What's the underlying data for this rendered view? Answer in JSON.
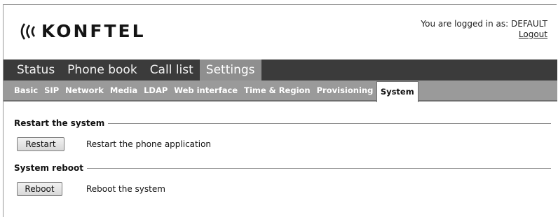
{
  "header": {
    "logo_text": "KONFTEL",
    "logged_in_text": "You are logged in as: DEFAULT",
    "logout_label": "Logout"
  },
  "main_nav": {
    "items": [
      {
        "label": "Status"
      },
      {
        "label": "Phone book"
      },
      {
        "label": "Call list"
      },
      {
        "label": "Settings"
      }
    ],
    "active": "Settings"
  },
  "sub_nav": {
    "items": [
      {
        "label": "Basic"
      },
      {
        "label": "SIP"
      },
      {
        "label": "Network"
      },
      {
        "label": "Media"
      },
      {
        "label": "LDAP"
      },
      {
        "label": "Web interface"
      },
      {
        "label": "Time & Region"
      },
      {
        "label": "Provisioning"
      },
      {
        "label": "System"
      }
    ],
    "active": "System"
  },
  "sections": {
    "restart": {
      "title": "Restart the system",
      "button_label": "Restart",
      "description": "Restart the phone application"
    },
    "reboot": {
      "title": "System reboot",
      "button_label": "Reboot",
      "description": "Reboot the system"
    }
  },
  "colors": {
    "main_nav_bg": "#3b3b3b",
    "main_nav_active": "#8f8f8f",
    "sub_nav_bg": "#9a9a9a"
  }
}
